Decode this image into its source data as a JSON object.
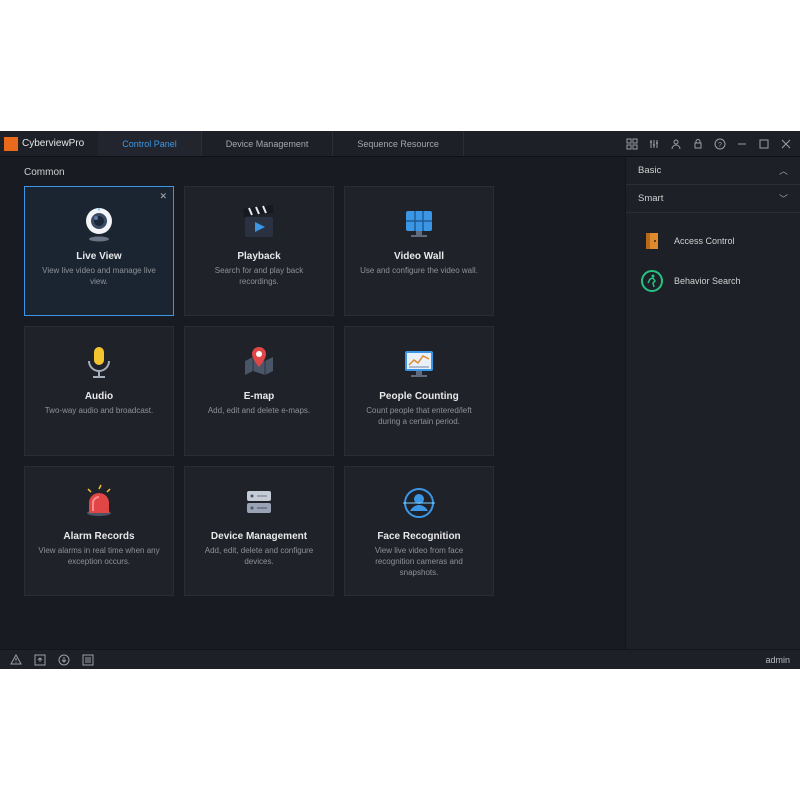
{
  "app": {
    "name": "CyberviewPro"
  },
  "tabs": [
    {
      "label": "Control Panel",
      "active": true
    },
    {
      "label": "Device Management",
      "active": false
    },
    {
      "label": "Sequence Resource",
      "active": false
    }
  ],
  "section_label": "Common",
  "cards": [
    {
      "title": "Live View",
      "desc": "View live video and manage live view.",
      "selected": true,
      "closable": true
    },
    {
      "title": "Playback",
      "desc": "Search for and play back recordings."
    },
    {
      "title": "Video Wall",
      "desc": "Use and configure the video wall."
    },
    {
      "title": "Audio",
      "desc": "Two-way audio and broadcast."
    },
    {
      "title": "E-map",
      "desc": "Add, edit and delete e-maps."
    },
    {
      "title": "People Counting",
      "desc": "Count people that entered/left during a certain period."
    },
    {
      "title": "Alarm Records",
      "desc": "View alarms in real time when any exception occurs."
    },
    {
      "title": "Device Management",
      "desc": "Add, edit, delete and configure devices."
    },
    {
      "title": "Face Recognition",
      "desc": "View live video from face recognition cameras and snapshots."
    }
  ],
  "sidebar": {
    "sections": [
      {
        "label": "Basic",
        "open": false
      },
      {
        "label": "Smart",
        "open": true
      }
    ],
    "items": [
      {
        "label": "Access Control"
      },
      {
        "label": "Behavior Search"
      }
    ]
  },
  "statusbar": {
    "user": "admin"
  }
}
